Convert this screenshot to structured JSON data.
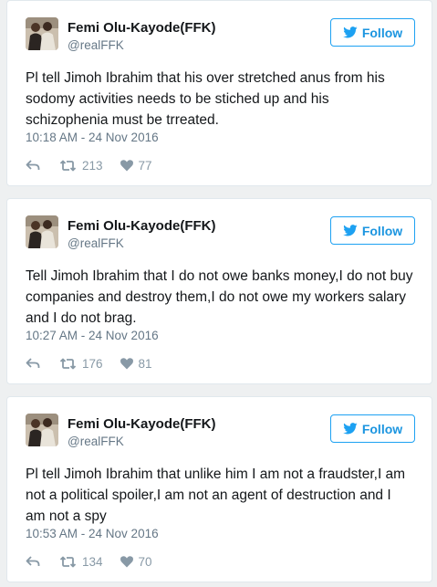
{
  "tweets": [
    {
      "author_name": "Femi Olu-Kayode(FFK)",
      "handle": "@realFFK",
      "follow_label": "Follow",
      "text": "Pl tell Jimoh Ibrahim that his over stretched anus from his sodomy activities needs to be stiched up and his schizophenia must be trreated.",
      "timestamp": "10:18 AM - 24 Nov 2016",
      "retweets": "213",
      "likes": "77"
    },
    {
      "author_name": "Femi Olu-Kayode(FFK)",
      "handle": "@realFFK",
      "follow_label": "Follow",
      "text": "Tell Jimoh Ibrahim that I do not owe banks money,I do not buy companies and destroy them,I do not owe my workers salary and I do not brag.",
      "timestamp": "10:27 AM - 24 Nov 2016",
      "retweets": "176",
      "likes": "81"
    },
    {
      "author_name": "Femi Olu-Kayode(FFK)",
      "handle": "@realFFK",
      "follow_label": "Follow",
      "text": "Pl tell Jimoh Ibrahim that unlike him I am not a fraudster,I am not a political spoiler,I am not an agent of destruction and I am not a spy",
      "timestamp": "10:53 AM - 24 Nov 2016",
      "retweets": "134",
      "likes": "70"
    }
  ],
  "icons": {
    "follow": "twitter-bird-icon",
    "reply": "reply-icon",
    "retweet": "retweet-icon",
    "like": "heart-icon"
  },
  "colors": {
    "accent": "#1da1f2",
    "text": "#14171a",
    "muted": "#657786",
    "icon": "#8899a6",
    "border": "#e1e8ed",
    "background": "#eef0f1"
  }
}
